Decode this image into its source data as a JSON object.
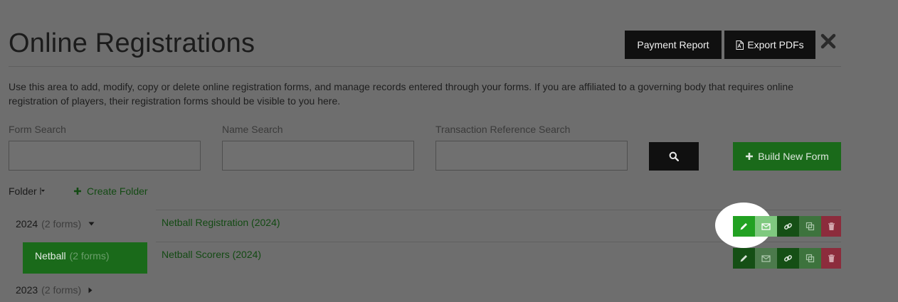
{
  "header": {
    "title": "Online Registrations",
    "payment_report_label": "Payment Report",
    "export_pdfs_label": "Export PDFs"
  },
  "description": "Use this area to add, modify, copy or delete online registration forms, and manage records entered through your forms. If you are affiliated to a governing body that requires online registration of players, their registration forms should be visible to you here.",
  "search": {
    "form_label": "Form Search",
    "name_label": "Name Search",
    "transaction_label": "Transaction Reference Search",
    "form_value": "",
    "name_value": "",
    "transaction_value": ""
  },
  "build_label": "Build New Form",
  "folder": {
    "label": "Folder",
    "create_label": "Create Folder",
    "groups": [
      {
        "name": "2024",
        "count": "(2 forms)"
      },
      {
        "name": "Netball",
        "count": "(2 forms)"
      },
      {
        "name": "2023",
        "count": "(2 forms)"
      }
    ]
  },
  "forms": [
    {
      "title": "Netball Registration (2024)"
    },
    {
      "title": "Netball Scorers (2024)"
    }
  ],
  "colors": {
    "background": "#6e6e6e",
    "brand_green": "#1a6a1a",
    "delete_red": "#8c2c3c",
    "dark_button": "#101010"
  }
}
